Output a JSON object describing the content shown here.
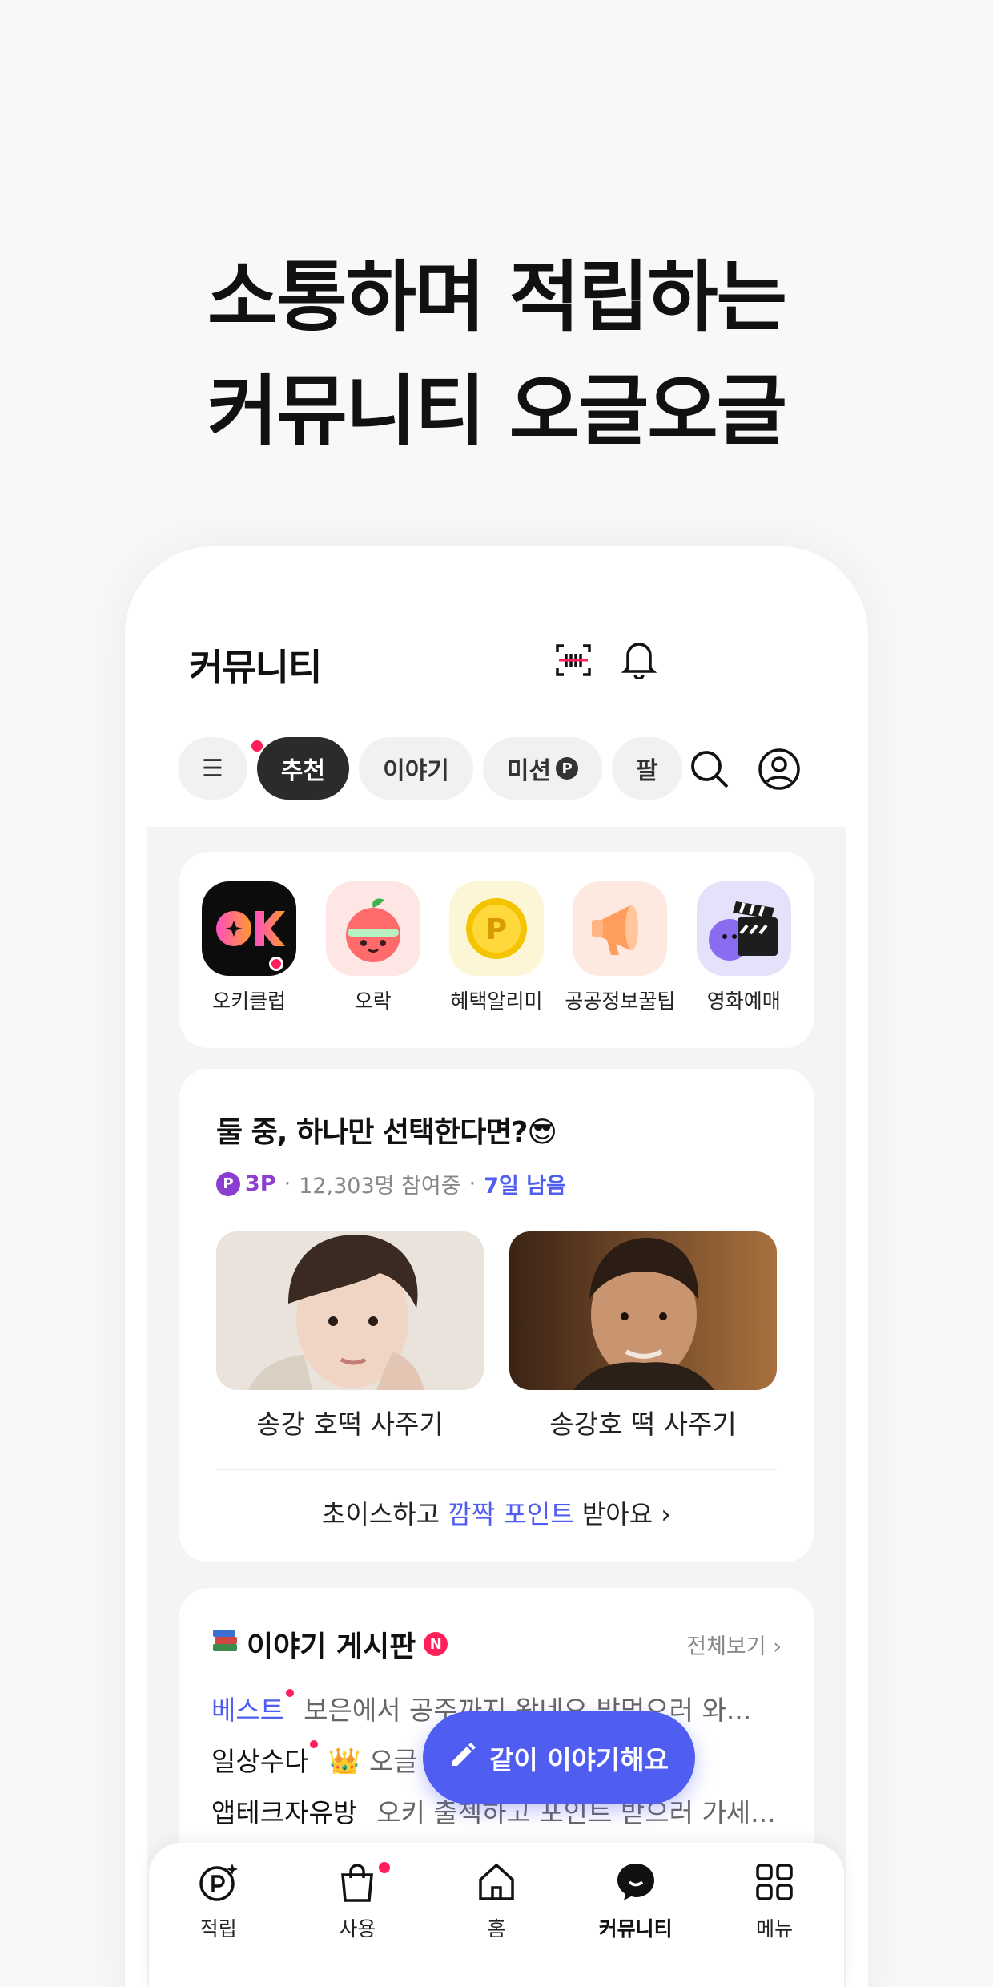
{
  "headline": {
    "line1": "소통하며 적립하는",
    "line2": "커뮤니티 오글오글"
  },
  "topbar": {
    "title": "커뮤니티"
  },
  "chips": [
    {
      "label": "☰"
    },
    {
      "label": "추천"
    },
    {
      "label": "이야기"
    },
    {
      "label": "미션",
      "badge": "P"
    },
    {
      "label": "팔"
    }
  ],
  "quick_menu": [
    {
      "label": "오키클럽"
    },
    {
      "label": "오락"
    },
    {
      "label": "혜택알리미"
    },
    {
      "label": "공공정보꿀팁"
    },
    {
      "label": "영화예매"
    }
  ],
  "vote": {
    "title": "둘 중, 하나만 선택한다면?😎",
    "points_badge": "P",
    "points": "3P",
    "participants": "12,303명 참여중",
    "remaining": "7일 남음",
    "choice_a": "송강 호떡 사주기",
    "choice_b": "송강호 떡 사주기",
    "cta_prefix": "초이스하고",
    "cta_highlight": "깜짝 포인트",
    "cta_suffix": "받아요 ›"
  },
  "board": {
    "title": "이야기 게시판",
    "new_badge": "N",
    "view_all": "전체보기 ›",
    "rows": [
      {
        "category": "베스트",
        "text": "보은에서 공주까지 왔네요 밥먹으러 와..."
      },
      {
        "category": "일상수다",
        "text": "👑 오글 월 포인트"
      },
      {
        "category": "앱테크자유방",
        "text": "오키 출첵하고 포인트 받으러 가세..."
      }
    ]
  },
  "fab": {
    "label": "같이 이야기해요"
  },
  "tabbar": [
    {
      "label": "적립"
    },
    {
      "label": "사용"
    },
    {
      "label": "홈"
    },
    {
      "label": "커뮤니티"
    },
    {
      "label": "메뉴"
    }
  ],
  "colors": {
    "accent": "#4f5df0",
    "alert": "#ff1f5a",
    "points": "#8a3fd1"
  }
}
